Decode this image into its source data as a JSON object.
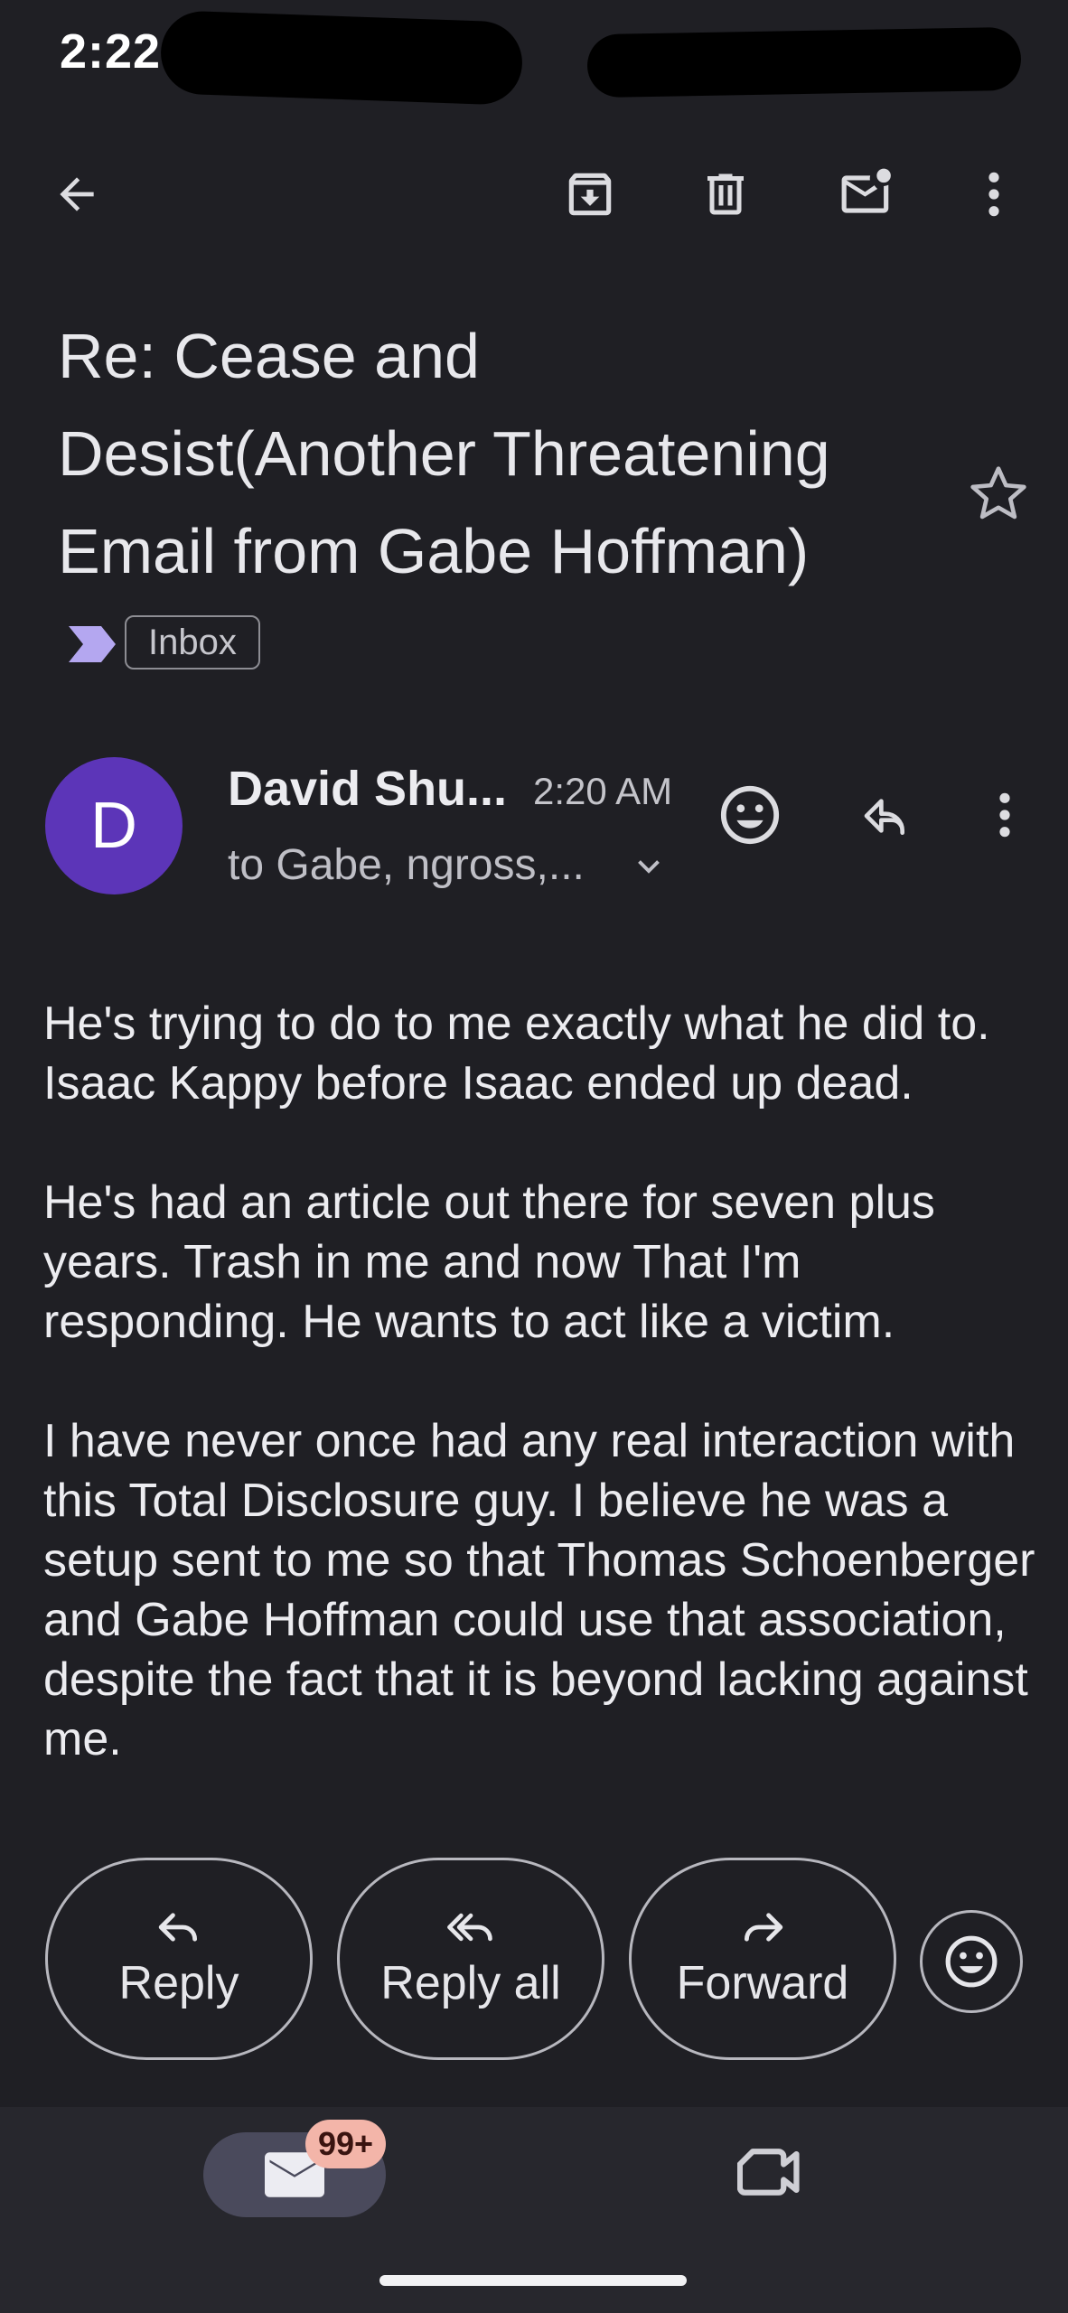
{
  "status_bar": {
    "time": "2:22"
  },
  "toolbar": {
    "back_icon": "arrow-left-icon",
    "archive_icon": "archive-icon",
    "delete_icon": "trash-icon",
    "mark_unread_icon": "mail-unread-icon",
    "more_icon": "more-vert-icon"
  },
  "email": {
    "subject_lines": [
      "Re: Cease and",
      "Desist(Another Threatening",
      "Email from Gabe Hoffman)"
    ],
    "label": "Inbox",
    "sender": {
      "avatar_letter": "D",
      "avatar_color": "#5c35b8",
      "name": "David Shu...",
      "time": "2:20 AM",
      "recipients": "to Gabe, ngross,..."
    },
    "body": [
      "He's trying to do to me exactly what he did to. Isaac Kappy before Isaac ended up dead.",
      "He's had an article out there for seven plus years. Trash in me and now That I'm responding. He wants to act like a victim.",
      "I have never once had any real interaction with this Total Disclosure guy. I believe he was a setup sent to me so that Thomas Schoenberger and Gabe Hoffman could use that association, despite the fact that it is beyond lacking against me."
    ]
  },
  "actions": {
    "reply": "Reply",
    "reply_all": "Reply all",
    "forward": "Forward"
  },
  "bottom_nav": {
    "mail_badge": "99+"
  },
  "colors": {
    "background": "#1f1f24",
    "badge": "#f3b5a9",
    "accent_label": "#b4a7f0"
  }
}
